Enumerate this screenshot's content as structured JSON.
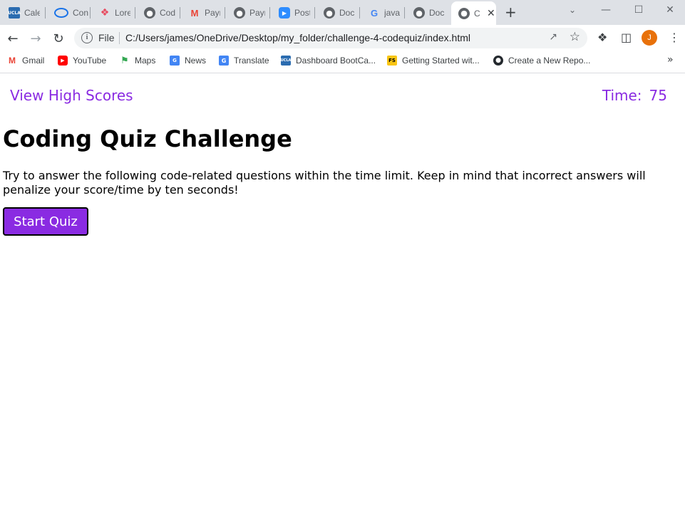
{
  "browser": {
    "tabs": [
      {
        "title": "Cale",
        "icon": "ucla-icon"
      },
      {
        "title": "Con",
        "icon": "canvas-icon"
      },
      {
        "title": "Lore",
        "icon": "lorem-icon"
      },
      {
        "title": "Cod",
        "icon": "globe-icon"
      },
      {
        "title": "Payr",
        "icon": "gmail-icon"
      },
      {
        "title": "Payr",
        "icon": "globe-icon"
      },
      {
        "title": "Post",
        "icon": "zoom-icon"
      },
      {
        "title": "Doc",
        "icon": "globe-icon"
      },
      {
        "title": "java",
        "icon": "google-icon"
      },
      {
        "title": "Doc",
        "icon": "globe-icon"
      },
      {
        "title": "C",
        "icon": "globe-icon",
        "active": true
      }
    ],
    "address": {
      "scheme_label": "File",
      "url": "C:/Users/james/OneDrive/Desktop/my_folder/challenge-4-codequiz/index.html"
    },
    "profile_initial": "J",
    "bookmarks": [
      {
        "label": "Gmail",
        "icon": "gmail-icon"
      },
      {
        "label": "YouTube",
        "icon": "youtube-icon"
      },
      {
        "label": "Maps",
        "icon": "maps-icon"
      },
      {
        "label": "News",
        "icon": "news-icon"
      },
      {
        "label": "Translate",
        "icon": "translate-icon"
      },
      {
        "label": "Dashboard BootCa...",
        "icon": "ucla-icon"
      },
      {
        "label": "Getting Started wit...",
        "icon": "fs-icon"
      },
      {
        "label": "Create a New Repo...",
        "icon": "github-icon"
      }
    ]
  },
  "page": {
    "high_scores_link": "View High Scores",
    "timer_label": "Time:",
    "timer_value": "75",
    "title": "Coding Quiz Challenge",
    "description": "Try to answer the following code-related questions within the time limit. Keep in mind that incorrect answers will penalize your score/time by ten seconds!",
    "start_button": "Start Quiz"
  },
  "colors": {
    "accent": "#8a2be2",
    "tabstrip_bg": "#dee1e6",
    "avatar": "#e8710a"
  }
}
